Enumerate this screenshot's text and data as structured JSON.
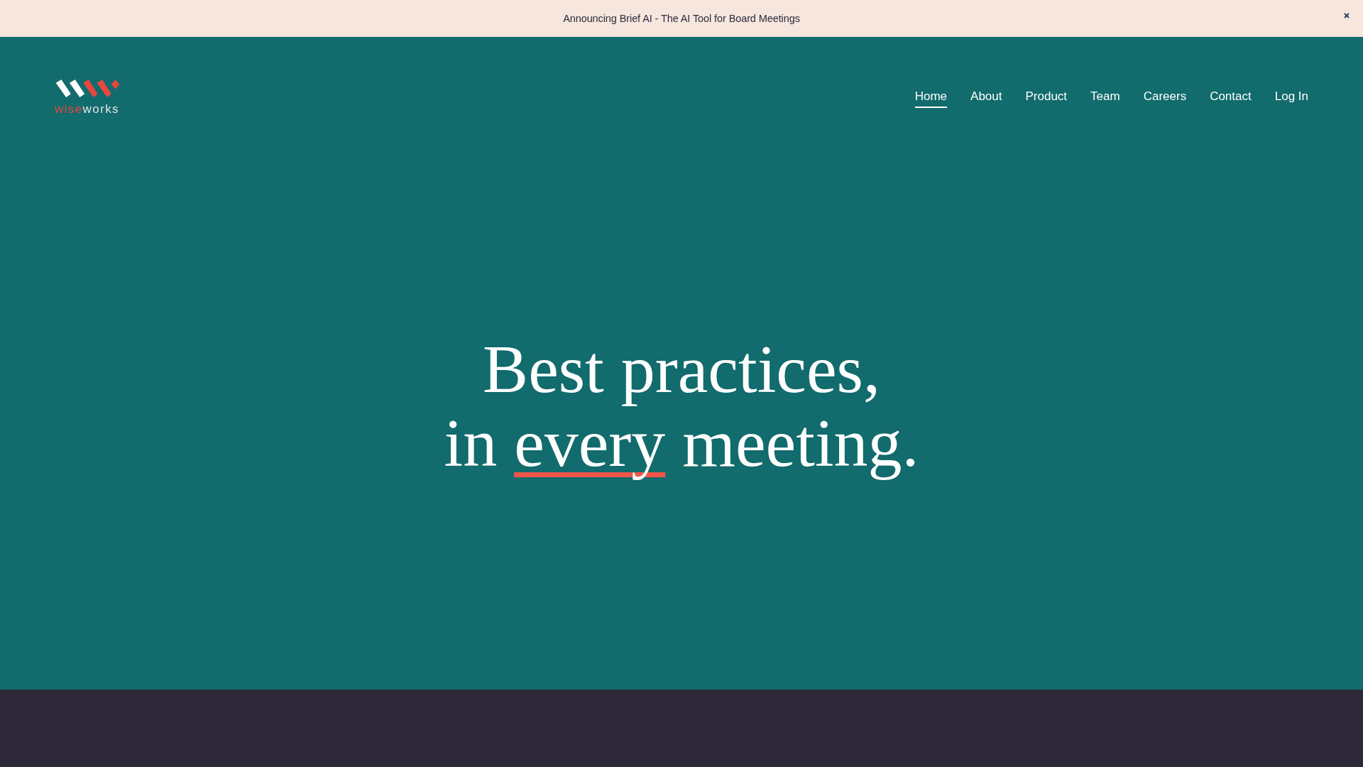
{
  "announcement_bar": {
    "text": "Announcing Brief AI - The AI Tool for Board Meetings"
  },
  "header": {
    "logo": {
      "wordmark_parts": [
        {
          "text": "wise",
          "color": "#e8473e"
        },
        {
          "text": "works",
          "color": "#dfe5e5"
        }
      ]
    },
    "nav": {
      "items": [
        {
          "label": "Home",
          "selected": true
        },
        {
          "label": "About",
          "selected": false
        },
        {
          "label": "Product",
          "selected": false
        },
        {
          "label": "Team",
          "selected": false
        },
        {
          "label": "Careers",
          "selected": false
        },
        {
          "label": "Contact",
          "selected": false
        },
        {
          "label": "Log In",
          "selected": false
        }
      ]
    }
  },
  "hero": {
    "headline": {
      "lines": [
        {
          "parts": [
            {
              "text": "Best practices,",
              "underlined": false
            }
          ]
        },
        {
          "parts": [
            {
              "text": "in ",
              "underlined": false
            },
            {
              "text": "every",
              "underlined": true
            },
            {
              "text": " meeting.",
              "underlined": false
            }
          ]
        }
      ]
    }
  }
}
